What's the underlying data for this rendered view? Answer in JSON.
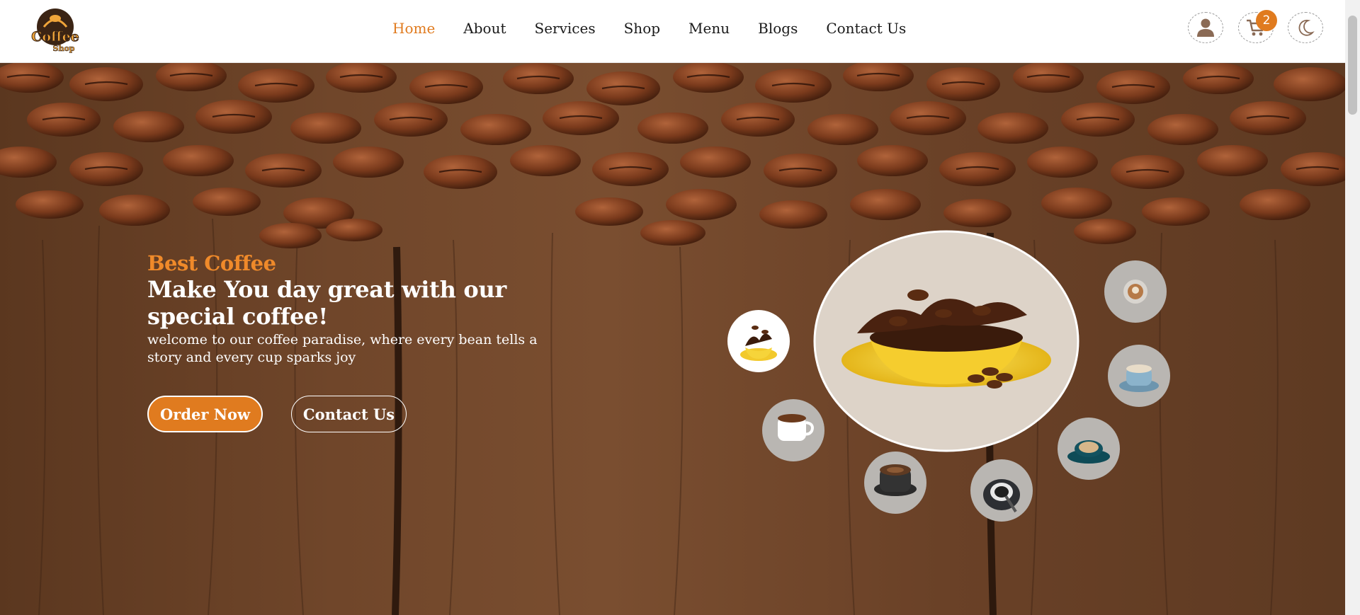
{
  "header": {
    "logo": {
      "line1": "Coffee",
      "line2": "Shop"
    },
    "nav": [
      {
        "label": "Home",
        "active": true
      },
      {
        "label": "About"
      },
      {
        "label": "Services"
      },
      {
        "label": "Shop"
      },
      {
        "label": "Menu"
      },
      {
        "label": "Blogs"
      },
      {
        "label": "Contact Us"
      }
    ],
    "icons": {
      "account": "user-icon",
      "cart": "cart-icon",
      "theme": "moon-icon"
    },
    "cart_count": "2"
  },
  "hero": {
    "eyebrow": "Best Coffee",
    "headline": "Make You day great with our special coffee!",
    "subtext": "welcome to our coffee paradise, where every bean tells a story and every cup sparks joy",
    "buttons": {
      "order": "Order Now",
      "contact": "Contact Us"
    },
    "featured_image": "yellow-cup-coffee-splash",
    "thumbnails": [
      "yellow-cup-coffee-splash",
      "white-cup-espresso",
      "black-cup-coffee",
      "dark-cup-with-spoon",
      "teal-cup-latte-art",
      "blue-cup-cappuccino",
      "latte-art-top-view"
    ]
  },
  "colors": {
    "accent": "#e07b1f",
    "text_dark": "#1a1a1a",
    "wood": "#5a3620"
  }
}
